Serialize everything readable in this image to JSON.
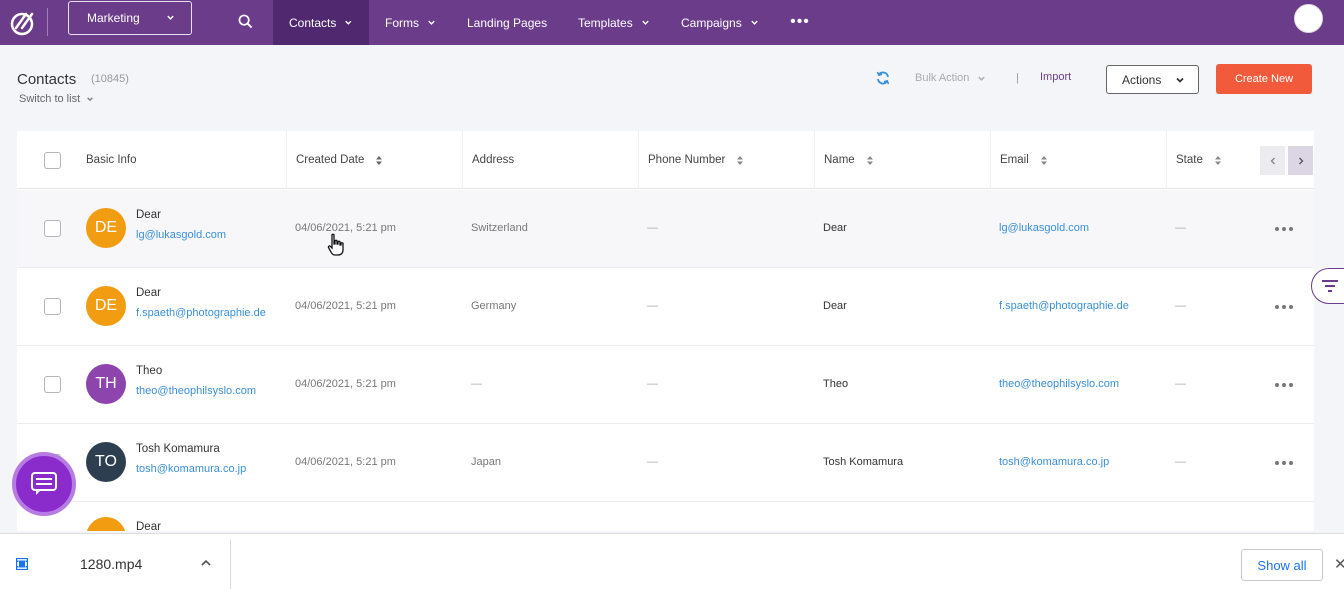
{
  "topbar": {
    "workspace": "Marketing",
    "nav": [
      {
        "label": "Contacts",
        "dropdown": true,
        "active": true
      },
      {
        "label": "Forms",
        "dropdown": true
      },
      {
        "label": "Landing Pages",
        "dropdown": false
      },
      {
        "label": "Templates",
        "dropdown": true
      },
      {
        "label": "Campaigns",
        "dropdown": true
      }
    ],
    "more": "•••"
  },
  "header": {
    "title": "Contacts",
    "count": "(10845)",
    "switch_label": "Switch to list",
    "bulk_action": "Bulk Action",
    "separator": "|",
    "import": "Import",
    "actions": "Actions",
    "create_new": "Create New"
  },
  "table": {
    "columns": [
      "Basic Info",
      "Created Date",
      "Address",
      "Phone Number",
      "Name",
      "Email",
      "State"
    ],
    "rows": [
      {
        "initials": "DE",
        "avatar_color": "#f29c11",
        "name": "Dear",
        "email": "lg@lukasgold.com",
        "created": "04/06/2021, 5:21 pm",
        "address": "Switzerland",
        "phone": "—",
        "name_col": "Dear",
        "email_col": "lg@lukasgold.com",
        "state": "—"
      },
      {
        "initials": "DE",
        "avatar_color": "#f29c11",
        "name": "Dear",
        "email": "f.spaeth@photographie.de",
        "created": "04/06/2021, 5:21 pm",
        "address": "Germany",
        "phone": "—",
        "name_col": "Dear",
        "email_col": "f.spaeth@photographie.de",
        "state": "—"
      },
      {
        "initials": "TH",
        "avatar_color": "#8e44ad",
        "name": "Theo",
        "email": "theo@theophilsyslo.com",
        "created": "04/06/2021, 5:21 pm",
        "address": "—",
        "phone": "—",
        "name_col": "Theo",
        "email_col": "theo@theophilsyslo.com",
        "state": "—"
      },
      {
        "initials": "TO",
        "avatar_color": "#2c3e50",
        "name": "Tosh Komamura",
        "email": "tosh@komamura.co.jp",
        "created": "04/06/2021, 5:21 pm",
        "address": "Japan",
        "phone": "—",
        "name_col": "Tosh Komamura",
        "email_col": "tosh@komamura.co.jp",
        "state": "—"
      },
      {
        "initials": "",
        "avatar_color": "#f29c11",
        "name": "Dear",
        "email": "",
        "created": "",
        "address": "",
        "phone": "",
        "name_col": "",
        "email_col": "",
        "state": ""
      }
    ]
  },
  "download_bar": {
    "filename": "1280.mp4",
    "show_all": "Show all",
    "close": "✕"
  },
  "colors": {
    "nav_bg": "#6b3c8a",
    "nav_active": "#4f2870",
    "accent_orange": "#f15a3a",
    "link_blue": "#3a8fd9",
    "chat_purple": "#8a2ccc"
  }
}
